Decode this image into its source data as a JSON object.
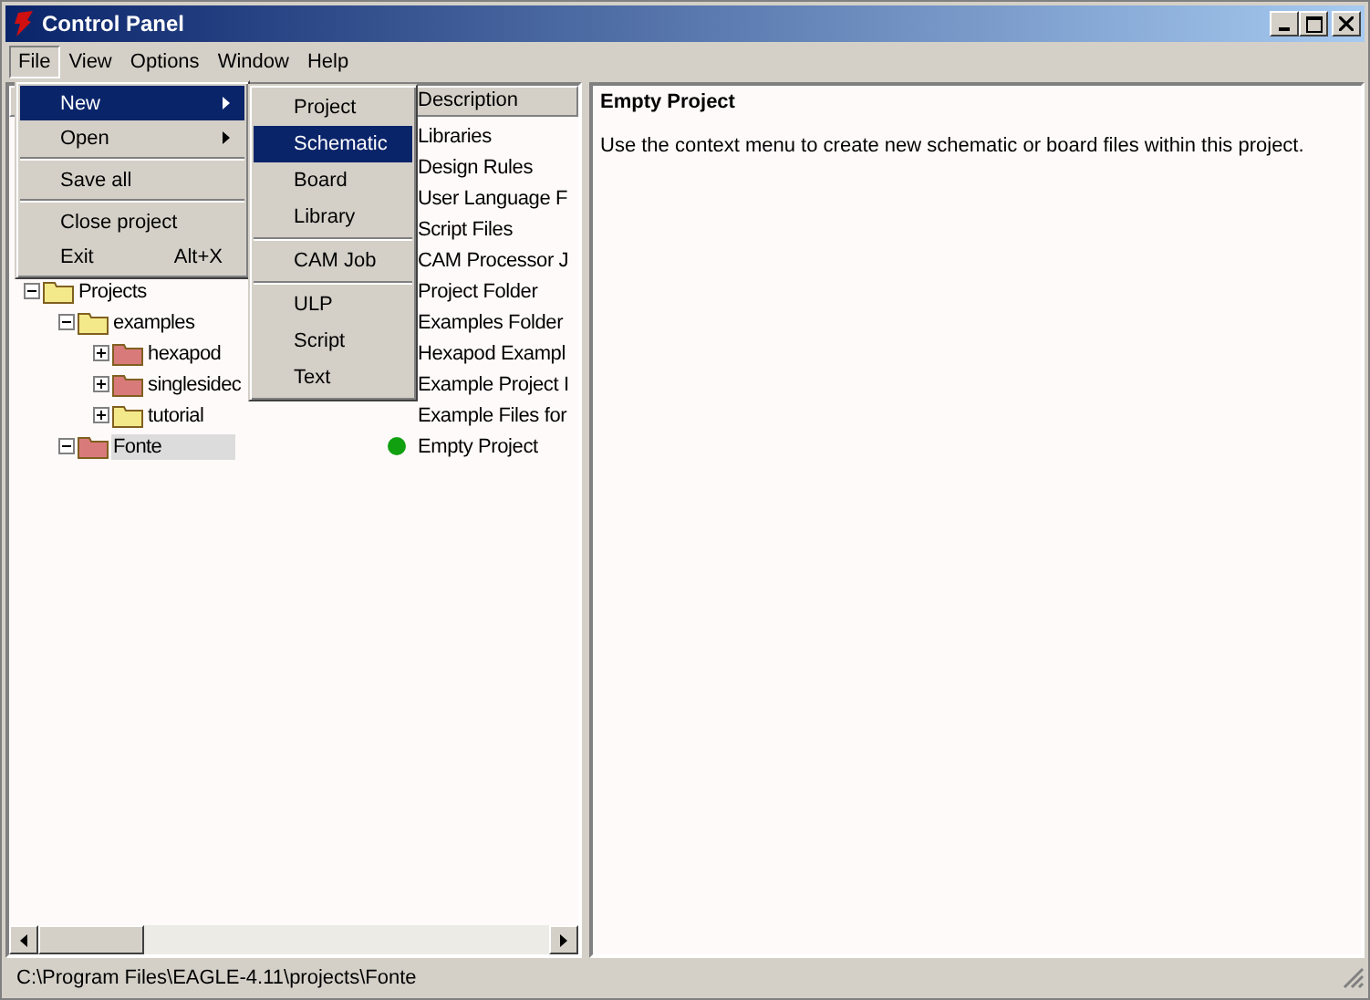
{
  "window": {
    "title": "Control Panel"
  },
  "menu_bar": [
    {
      "label": "File",
      "selected": true
    },
    {
      "label": "View",
      "selected": false
    },
    {
      "label": "Options",
      "selected": false
    },
    {
      "label": "Window",
      "selected": false
    },
    {
      "label": "Help",
      "selected": false
    }
  ],
  "file_menu": [
    {
      "kind": "item",
      "label": "New",
      "submenu": true,
      "selected": true
    },
    {
      "kind": "item",
      "label": "Open",
      "submenu": true,
      "selected": false
    },
    {
      "kind": "separator"
    },
    {
      "kind": "item",
      "label": "Save all",
      "submenu": false,
      "selected": false
    },
    {
      "kind": "separator"
    },
    {
      "kind": "item",
      "label": "Close project",
      "submenu": false,
      "selected": false
    },
    {
      "kind": "item",
      "label": "Exit",
      "shortcut": "Alt+X",
      "submenu": false,
      "selected": false
    }
  ],
  "new_submenu": [
    {
      "kind": "item",
      "label": "Project",
      "selected": false
    },
    {
      "kind": "item",
      "label": "Schematic",
      "selected": true
    },
    {
      "kind": "item",
      "label": "Board",
      "selected": false
    },
    {
      "kind": "item",
      "label": "Library",
      "selected": false
    },
    {
      "kind": "separator"
    },
    {
      "kind": "item",
      "label": "CAM Job",
      "selected": false
    },
    {
      "kind": "separator"
    },
    {
      "kind": "item",
      "label": "ULP",
      "selected": false
    },
    {
      "kind": "item",
      "label": "Script",
      "selected": false
    },
    {
      "kind": "item",
      "label": "Text",
      "selected": false
    }
  ],
  "tree": {
    "description_header": "Description",
    "items": [
      {
        "description": "Libraries"
      },
      {
        "description": "Design Rules"
      },
      {
        "description": "User Language F"
      },
      {
        "description": "Script Files"
      },
      {
        "description": "CAM Processor J"
      },
      {
        "name": "Projects",
        "kind": "folder",
        "expanded": true,
        "selected": false,
        "open": false,
        "description": "Project Folder",
        "children": [
          {
            "name": "examples",
            "kind": "folder",
            "expanded": true,
            "selected": false,
            "open": false,
            "description": "Examples Folder",
            "children": [
              {
                "name": "hexapod",
                "kind": "project",
                "expanded": false,
                "selected": false,
                "open": false,
                "description": "Hexapod Exampl"
              },
              {
                "name": "singlesidec",
                "kind": "project",
                "expanded": false,
                "selected": false,
                "open": false,
                "description": "Example Project I"
              },
              {
                "name": "tutorial",
                "kind": "folder",
                "expanded": false,
                "selected": false,
                "open": false,
                "description": "Example Files for"
              }
            ]
          },
          {
            "name": "Fonte",
            "kind": "project",
            "expanded": true,
            "selected": true,
            "open": true,
            "description": "Empty Project"
          }
        ]
      }
    ]
  },
  "details": {
    "title": "Empty Project",
    "text": "Use the context menu to create new schematic or board files within this project."
  },
  "status_bar": "C:\\Program Files\\EAGLE-4.11\\projects\\Fonte"
}
